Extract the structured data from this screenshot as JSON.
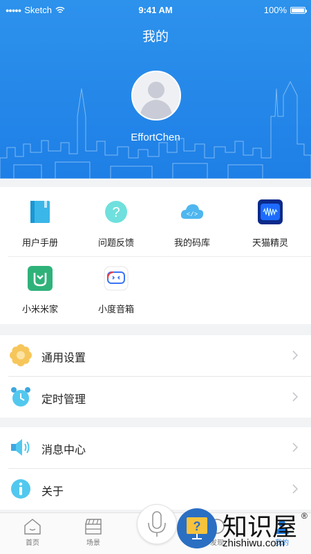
{
  "status_bar": {
    "carrier": "Sketch",
    "time": "9:41 AM",
    "battery": "100%"
  },
  "header": {
    "title": "我的",
    "username": "EffortChen"
  },
  "grid": [
    {
      "label": "用户手册",
      "icon": "book-icon"
    },
    {
      "label": "问题反馈",
      "icon": "question-icon"
    },
    {
      "label": "我的码库",
      "icon": "cloud-code-icon"
    },
    {
      "label": "天猫精灵",
      "icon": "tmall-genie-icon"
    },
    {
      "label": "小米米家",
      "icon": "mijia-icon"
    },
    {
      "label": "小度音箱",
      "icon": "xiaodu-icon"
    }
  ],
  "settings_list": [
    {
      "label": "通用设置",
      "icon": "gear-flower-icon"
    },
    {
      "label": "定时管理",
      "icon": "alarm-clock-icon"
    }
  ],
  "info_list": [
    {
      "label": "消息中心",
      "icon": "speaker-icon"
    },
    {
      "label": "关于",
      "icon": "info-icon"
    }
  ],
  "tabbar": [
    {
      "label": "首页",
      "icon": "home-icon"
    },
    {
      "label": "场景",
      "icon": "clapperboard-icon"
    },
    {
      "label": "发现",
      "icon": "discover-icon"
    },
    {
      "label": "我的",
      "icon": "profile-icon"
    }
  ],
  "watermark": {
    "text": "知识屋",
    "sub": "zhishiwu.com",
    "mark": "®"
  },
  "colors": {
    "primary": "#1e7fe6",
    "background": "#f2f3f5"
  }
}
